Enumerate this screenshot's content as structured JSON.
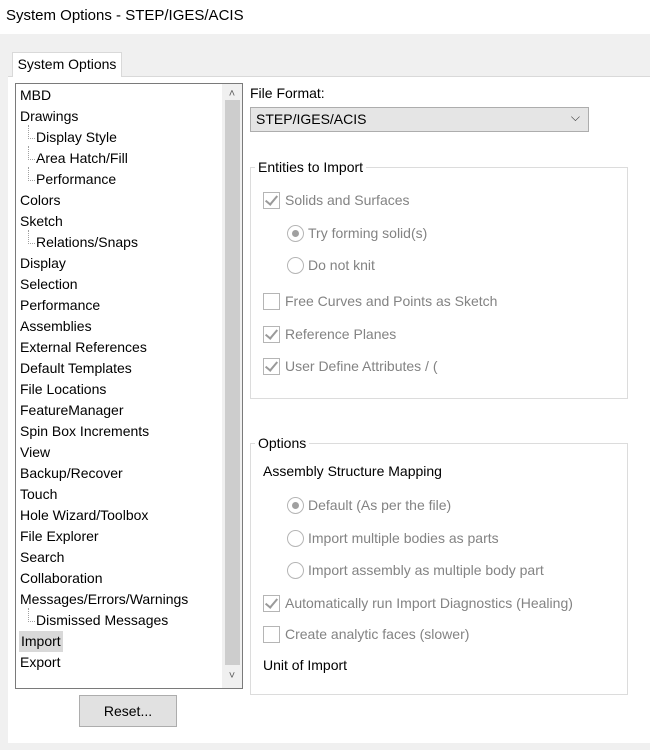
{
  "window": {
    "title": "System Options - STEP/IGES/ACIS"
  },
  "tabs": [
    {
      "label": "System Options"
    }
  ],
  "tree": {
    "items": [
      {
        "label": "MBD",
        "child": false
      },
      {
        "label": "Drawings",
        "child": false
      },
      {
        "label": "Display Style",
        "child": true
      },
      {
        "label": "Area Hatch/Fill",
        "child": true
      },
      {
        "label": "Performance",
        "child": true
      },
      {
        "label": "Colors",
        "child": false
      },
      {
        "label": "Sketch",
        "child": false
      },
      {
        "label": "Relations/Snaps",
        "child": true
      },
      {
        "label": "Display",
        "child": false
      },
      {
        "label": "Selection",
        "child": false
      },
      {
        "label": "Performance",
        "child": false
      },
      {
        "label": "Assemblies",
        "child": false
      },
      {
        "label": "External References",
        "child": false
      },
      {
        "label": "Default Templates",
        "child": false
      },
      {
        "label": "File Locations",
        "child": false
      },
      {
        "label": "FeatureManager",
        "child": false
      },
      {
        "label": "Spin Box Increments",
        "child": false
      },
      {
        "label": "View",
        "child": false
      },
      {
        "label": "Backup/Recover",
        "child": false
      },
      {
        "label": "Touch",
        "child": false
      },
      {
        "label": "Hole Wizard/Toolbox",
        "child": false
      },
      {
        "label": "File Explorer",
        "child": false
      },
      {
        "label": "Search",
        "child": false
      },
      {
        "label": "Collaboration",
        "child": false
      },
      {
        "label": "Messages/Errors/Warnings",
        "child": false
      },
      {
        "label": "Dismissed Messages",
        "child": true
      },
      {
        "label": "Import",
        "child": false,
        "selected": true
      },
      {
        "label": "Export",
        "child": false
      }
    ]
  },
  "reset_label": "Reset...",
  "file_format": {
    "label": "File Format:",
    "value": "STEP/IGES/ACIS"
  },
  "entities": {
    "title": "Entities to Import",
    "solids_surfaces": "Solids and Surfaces",
    "try_forming_solids": "Try forming solid(s)",
    "do_not_knit": "Do not knit",
    "free_curves": "Free Curves and Points as Sketch",
    "reference_planes": "Reference Planes",
    "user_attributes": "User Define Attributes / ("
  },
  "options": {
    "title": "Options",
    "assembly_mapping": "Assembly Structure Mapping",
    "default_mapping": "Default (As per the file)",
    "import_bodies_as_parts": "Import multiple bodies as parts",
    "import_assembly_as_body": "Import assembly as multiple body part",
    "auto_diagnostics": "Automatically run Import Diagnostics (Healing)",
    "analytic_faces": "Create analytic faces (slower)",
    "unit_of_import": "Unit of Import"
  }
}
